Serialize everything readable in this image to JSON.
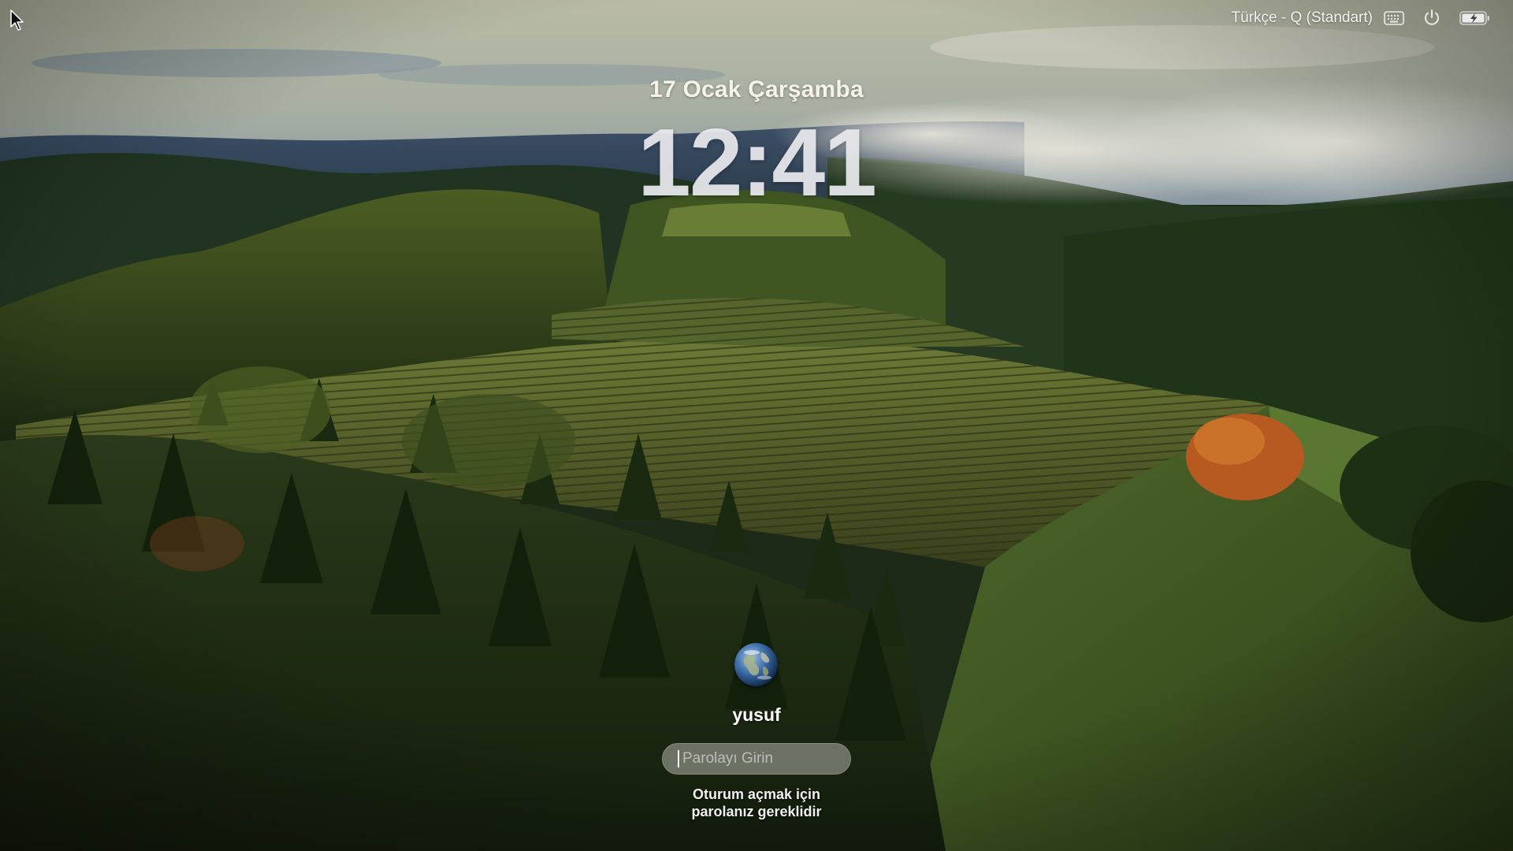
{
  "topbar": {
    "input_source_label": "Türkçe - Q (Standart)",
    "keyboard_icon": "keyboard-icon",
    "power_icon": "power-icon",
    "battery_icon": "battery-charging-icon"
  },
  "lock_screen": {
    "date": "17 Ocak Çarşamba",
    "time": "12:41"
  },
  "login": {
    "avatar_icon": "globe-avatar",
    "username": "yusuf",
    "password_placeholder": "Parolayı Girin",
    "hint_line_1": "Oturum açmak için",
    "hint_line_2": "parolanız gereklidir"
  },
  "colors": {
    "text": "#ffffff",
    "field_bg": "#afb2a8"
  }
}
